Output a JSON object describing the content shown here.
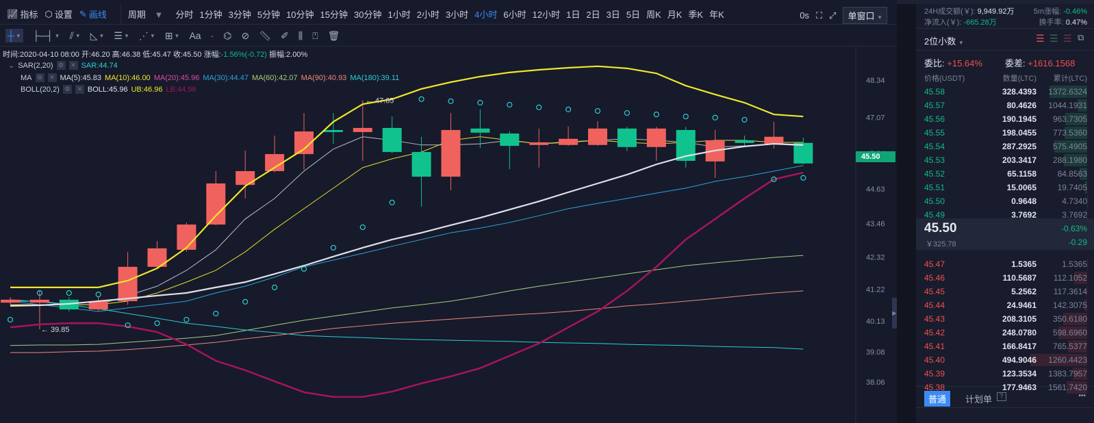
{
  "toolbar": {
    "indicators": "指标",
    "settings": "设置",
    "draw": "画线",
    "period": "周期",
    "periods": [
      "分时",
      "1分钟",
      "3分钟",
      "5分钟",
      "10分钟",
      "15分钟",
      "30分钟",
      "1小时",
      "2小时",
      "3小时",
      "4小时",
      "6小时",
      "12小时",
      "1日",
      "2日",
      "3日",
      "5日",
      "周K",
      "月K",
      "季K",
      "年K"
    ],
    "active_period": "4小时",
    "timer": "0s",
    "window_mode": "单窗口"
  },
  "draw_tools": [
    "crosshair-icon",
    "horizontal-line-icon",
    "trend-lines-icon",
    "angle-icon",
    "parallel-lines-icon",
    "fibonacci-icon",
    "rectangle-icon",
    "text-icon",
    "pattern-icon",
    "magnet-icon",
    "ruler-icon",
    "pencil-icon",
    "measure-icon",
    "lock-icon",
    "trash-icon"
  ],
  "draw_text_tool": "Aa",
  "ohlc": {
    "time": "时间:2020-04-10 08:00",
    "open": "开:46.20",
    "high": "高:46.38",
    "low": "低:45.47",
    "close": "收:45.50",
    "change_label": "涨幅:",
    "change": "-1.56%(-0.72)",
    "amplitude": "振幅:2.00%"
  },
  "indicators": {
    "sar": {
      "name": "SAR(2,20)",
      "value": "SAR:44.74"
    },
    "ma": {
      "name": "MA",
      "values": [
        {
          "t": "MA(5):45.83",
          "color": "#d9dbe4"
        },
        {
          "t": "MA(10):46.00",
          "color": "#f2e52b"
        },
        {
          "t": "MA(20):45.96",
          "color": "#d84ea6"
        },
        {
          "t": "MA(30):44.47",
          "color": "#2ea4d8"
        },
        {
          "t": "MA(60):42.07",
          "color": "#a6d07a"
        },
        {
          "t": "MA(90):40.93",
          "color": "#ef8a78"
        },
        {
          "t": "MA(180):39.11",
          "color": "#2ad0d0"
        }
      ]
    },
    "boll": {
      "name": "BOLL(20,2)",
      "mid": "BOLL:45.96",
      "ub": "UB:46.96",
      "lb": "LB:44.96"
    }
  },
  "colors": {
    "up": "#f0625e",
    "down": "#10c38e",
    "accent": "#3d8bf2"
  },
  "chart_data": {
    "type": "candlestick",
    "y_ticks": [
      "48.34",
      "47.07",
      "45.84",
      "44.63",
      "43.46",
      "42.32",
      "41.22",
      "40.13",
      "39.08",
      "38.06"
    ],
    "ylim": [
      38.06,
      48.34
    ],
    "last_price": "45.50",
    "annotations": {
      "high": "← 47.65",
      "low": "← 39.85"
    },
    "candles": [
      [
        40.76,
        40.95,
        40.7,
        40.86
      ],
      [
        40.76,
        41.16,
        39.85,
        40.86
      ],
      [
        40.86,
        40.95,
        40.46,
        40.53
      ],
      [
        40.53,
        40.95,
        40.46,
        40.81
      ],
      [
        40.81,
        42.49,
        40.69,
        41.98
      ],
      [
        41.98,
        42.86,
        41.93,
        42.61
      ],
      [
        42.56,
        43.49,
        42.49,
        43.42
      ],
      [
        43.42,
        45.24,
        43.4,
        44.82
      ],
      [
        44.77,
        45.94,
        44.31,
        45.24
      ],
      [
        45.24,
        46.45,
        45.2,
        45.82
      ],
      [
        45.82,
        47.22,
        45.29,
        46.59
      ],
      [
        46.64,
        47.22,
        46.17,
        46.57
      ],
      [
        46.57,
        47.65,
        45.59,
        46.71
      ],
      [
        46.71,
        47.1,
        45.85,
        45.89
      ],
      [
        45.89,
        46.41,
        44.03,
        45.05
      ],
      [
        45.05,
        47.22,
        44.59,
        46.64
      ],
      [
        46.69,
        47.34,
        46.03,
        46.55
      ],
      [
        46.52,
        46.6,
        45.31,
        46.1
      ],
      [
        46.13,
        46.69,
        45.36,
        46.22
      ],
      [
        46.13,
        46.76,
        46.1,
        46.34
      ],
      [
        46.13,
        46.94,
        46.1,
        46.69
      ],
      [
        46.69,
        46.75,
        45.92,
        46.06
      ],
      [
        46.06,
        46.75,
        45.59,
        46.69
      ],
      [
        46.64,
        46.75,
        45.36,
        45.59
      ],
      [
        45.57,
        46.64,
        45.01,
        46.29
      ],
      [
        46.29,
        46.45,
        46.1,
        46.2
      ],
      [
        46.17,
        46.92,
        46.01,
        46.41
      ],
      [
        46.2,
        46.38,
        45.47,
        45.5
      ]
    ],
    "series": [
      {
        "name": "UB",
        "color": "#f2e52b",
        "width": 2.2,
        "values": [
          41.28,
          41.28,
          41.28,
          41.28,
          41.51,
          41.93,
          42.63,
          43.72,
          44.73,
          45.36,
          45.99,
          46.92,
          47.52,
          47.69,
          48.04,
          48.27,
          48.46,
          48.6,
          48.69,
          48.76,
          48.81,
          48.74,
          48.57,
          48.15,
          47.85,
          47.57,
          47.17,
          47.1
        ]
      },
      {
        "name": "BOLL",
        "color": "#dfe1ea",
        "width": 2.2,
        "values": [
          40.65,
          40.67,
          40.72,
          40.81,
          40.9,
          41.0,
          41.09,
          41.28,
          41.46,
          41.74,
          42.02,
          42.33,
          42.63,
          42.91,
          43.14,
          43.4,
          43.65,
          43.93,
          44.21,
          44.52,
          44.82,
          45.12,
          45.47,
          45.75,
          45.94,
          46.08,
          46.17,
          46.13
        ]
      },
      {
        "name": "LB",
        "color": "#a3145f",
        "width": 2.6,
        "values": [
          39.92,
          40.02,
          40.06,
          40.06,
          39.95,
          39.76,
          39.34,
          38.78,
          38.46,
          38.08,
          37.71,
          37.55,
          37.55,
          37.73,
          38.01,
          38.25,
          38.53,
          38.95,
          39.37,
          39.92,
          40.46,
          41.16,
          41.98,
          42.91,
          43.61,
          44.31,
          44.96,
          45.19
        ]
      },
      {
        "name": "MA(5)",
        "color": "#b9bccb",
        "width": 1,
        "values": [
          40.81,
          40.81,
          40.69,
          40.69,
          41.0,
          41.32,
          41.86,
          42.56,
          43.61,
          44.31,
          45.24,
          45.99,
          46.41,
          46.29,
          46.13,
          46.13,
          46.17,
          46.29,
          46.17,
          46.24,
          46.29,
          46.34,
          46.29,
          46.22,
          46.06,
          46.1,
          46.17,
          46.1
        ]
      },
      {
        "name": "MA(10)",
        "color": "#e8dc2a",
        "width": 1,
        "values": [
          40.69,
          40.69,
          40.69,
          40.69,
          40.81,
          41.09,
          41.46,
          41.86,
          42.49,
          43.26,
          43.96,
          44.66,
          45.36,
          45.66,
          45.89,
          46.29,
          46.41,
          46.29,
          46.17,
          46.22,
          46.29,
          46.22,
          46.17,
          46.22,
          46.29,
          46.29,
          46.22,
          46.22
        ]
      },
      {
        "name": "MA(30)",
        "color": "#2ea4d8",
        "width": 1,
        "values": [
          40.81,
          40.69,
          40.58,
          40.46,
          40.58,
          40.69,
          40.81,
          41.09,
          41.32,
          41.63,
          41.98,
          42.21,
          42.44,
          42.68,
          42.91,
          43.14,
          43.3,
          43.49,
          43.72,
          43.96,
          44.14,
          44.31,
          44.49,
          44.66,
          44.89,
          45.05,
          45.24,
          45.43
        ]
      },
      {
        "name": "MA(60)",
        "color": "#a6d07a",
        "width": 1,
        "values": [
          39.3,
          39.32,
          39.32,
          39.34,
          39.41,
          39.48,
          39.55,
          39.64,
          39.81,
          39.99,
          40.16,
          40.3,
          40.44,
          40.58,
          40.69,
          40.81,
          40.97,
          41.16,
          41.32,
          41.46,
          41.6,
          41.74,
          41.88,
          42.02,
          42.12,
          42.21,
          42.3,
          42.37
        ]
      },
      {
        "name": "MA(90)",
        "color": "#ef8a78",
        "width": 1,
        "values": [
          39.06,
          39.06,
          39.09,
          39.11,
          39.16,
          39.23,
          39.32,
          39.41,
          39.53,
          39.64,
          39.76,
          39.88,
          39.97,
          40.06,
          40.13,
          40.2,
          40.27,
          40.34,
          40.39,
          40.46,
          40.55,
          40.65,
          40.72,
          40.81,
          40.9,
          41.0,
          41.09,
          41.16
        ]
      },
      {
        "name": "MA(180)",
        "color": "#2ad0d0",
        "width": 1,
        "values": [
          40.86,
          40.79,
          40.69,
          40.55,
          40.39,
          40.23,
          40.06,
          39.95,
          39.83,
          39.74,
          39.64,
          39.6,
          39.57,
          39.53,
          39.5,
          39.48,
          39.46,
          39.44,
          39.41,
          39.39,
          39.37,
          39.34,
          39.32,
          39.3,
          39.27,
          39.25,
          39.23,
          39.18
        ]
      }
    ],
    "sar": [
      40.18,
      41.09,
      41.09,
      41.04,
      39.99,
      40.06,
      40.18,
      40.39,
      40.79,
      41.28,
      41.91,
      42.63,
      43.33,
      44.17,
      47.69,
      47.62,
      47.57,
      47.5,
      47.41,
      47.34,
      47.29,
      47.22,
      47.17,
      47.1,
      47.06,
      46.99,
      44.96,
      45.01
    ]
  },
  "sidebar": {
    "vol_label": "24H成交额(￥):",
    "vol": "9,949.92万",
    "chg5m_label": "5m涨幅:",
    "chg5m": "-0.46%",
    "inflow_label": "净流入(￥):",
    "inflow": "-665.28万",
    "turnover_label": "换手率:",
    "turnover": "0.47%",
    "decimals": "2位小数",
    "ratio_label": "委比:",
    "ratio": "+15.64%",
    "diff_label": "委差:",
    "diff": "+1616.1568",
    "cols": [
      "价格(USDT)",
      "数量(LTC)",
      "累计(LTC)"
    ],
    "asks": [
      [
        "45.58",
        "328.4393",
        "1372.6324"
      ],
      [
        "45.57",
        "80.4626",
        "1044.1931"
      ],
      [
        "45.56",
        "190.1945",
        "963.7305"
      ],
      [
        "45.55",
        "198.0455",
        "773.5360"
      ],
      [
        "45.54",
        "287.2925",
        "575.4905"
      ],
      [
        "45.53",
        "203.3417",
        "288.1980"
      ],
      [
        "45.52",
        "65.1158",
        "84.8563"
      ],
      [
        "45.51",
        "15.0065",
        "19.7405"
      ],
      [
        "45.50",
        "0.9648",
        "4.7340"
      ],
      [
        "45.49",
        "3.7692",
        "3.7692"
      ]
    ],
    "last": {
      "price": "45.50",
      "cny": "￥325.78",
      "pct": "-0.63%",
      "chg": "-0.29"
    },
    "bids": [
      [
        "45.47",
        "1.5365",
        "1.5365"
      ],
      [
        "45.46",
        "110.5687",
        "112.1052"
      ],
      [
        "45.45",
        "5.2562",
        "117.3614"
      ],
      [
        "45.44",
        "24.9461",
        "142.3075"
      ],
      [
        "45.43",
        "208.3105",
        "350.6180"
      ],
      [
        "45.42",
        "248.0780",
        "598.6960"
      ],
      [
        "45.41",
        "166.8417",
        "765.5377"
      ],
      [
        "45.40",
        "494.9046",
        "1260.4423"
      ],
      [
        "45.39",
        "123.3534",
        "1383.7957"
      ],
      [
        "45.38",
        "177.9463",
        "1561.7420"
      ]
    ],
    "tab_normal": "普通",
    "tab_plan": "计划单",
    "help": "?",
    "more": "•••"
  }
}
